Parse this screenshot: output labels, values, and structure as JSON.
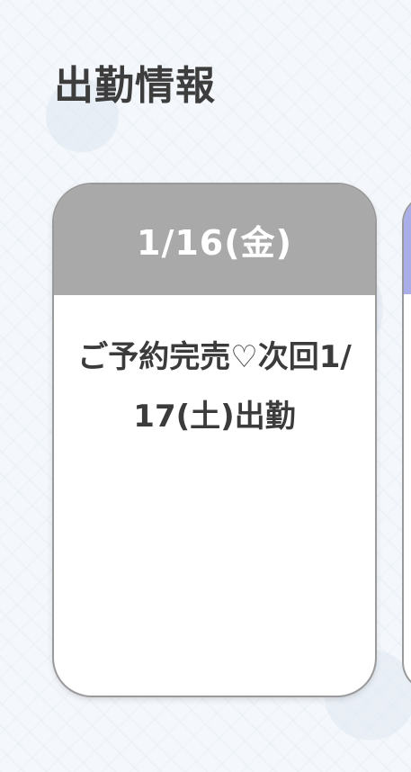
{
  "section": {
    "title": "出勤情報"
  },
  "schedule": [
    {
      "date": "1/16(金)",
      "message": "ご予約完売♡次回1/17(土)出勤",
      "header_color": "#a9a9a9"
    }
  ],
  "next_card": {
    "header_color": "#a9aee8"
  }
}
